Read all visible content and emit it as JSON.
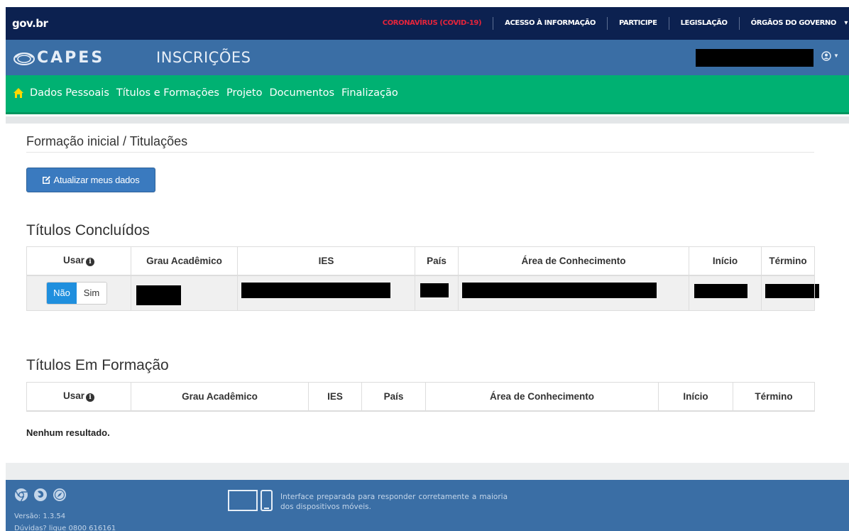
{
  "gov": {
    "logo": "gov.br",
    "links": [
      "CORONAVÍRUS (COVID-19)",
      "ACESSO À INFORMAÇÃO",
      "PARTICIPE",
      "LEGISLAÇÃO",
      "ÓRGÃOS DO GOVERNO"
    ],
    "alert_color": "#e5243b"
  },
  "header": {
    "brand": "CAPES",
    "app_title": "INSCRIÇÕES"
  },
  "nav": {
    "items": [
      "Dados Pessoais",
      "Títulos e Formações",
      "Projeto",
      "Documentos",
      "Finalização"
    ]
  },
  "formacao": {
    "title": "Formação inicial / Titulações",
    "update_button": "Atualizar meus dados"
  },
  "concluidos": {
    "title": "Títulos Concluídos",
    "columns": [
      "Usar",
      "Grau Acadêmico",
      "IES",
      "País",
      "Área de Conhecimento",
      "Início",
      "Término"
    ],
    "row": {
      "no_label": "Não",
      "yes_label": "Sim"
    }
  },
  "em_formacao": {
    "title": "Títulos Em Formação",
    "columns": [
      "Usar",
      "Grau Acadêmico",
      "IES",
      "País",
      "Área de Conhecimento",
      "Início",
      "Término"
    ],
    "empty_text": "Nenhum resultado."
  },
  "footer": {
    "version": "Versão: 1.3.54",
    "help": "Dúvidas? ligue 0800 616161",
    "responsive_note": "Interface preparada para responder corretamente a maioria dos dispositivos móveis."
  },
  "colors": {
    "gov_bar": "#0c2150",
    "capes_bar": "#3a6ea5",
    "nav_bar": "#00b172",
    "primary_button": "#3a7abf",
    "toggle_active": "#1f8fde"
  }
}
